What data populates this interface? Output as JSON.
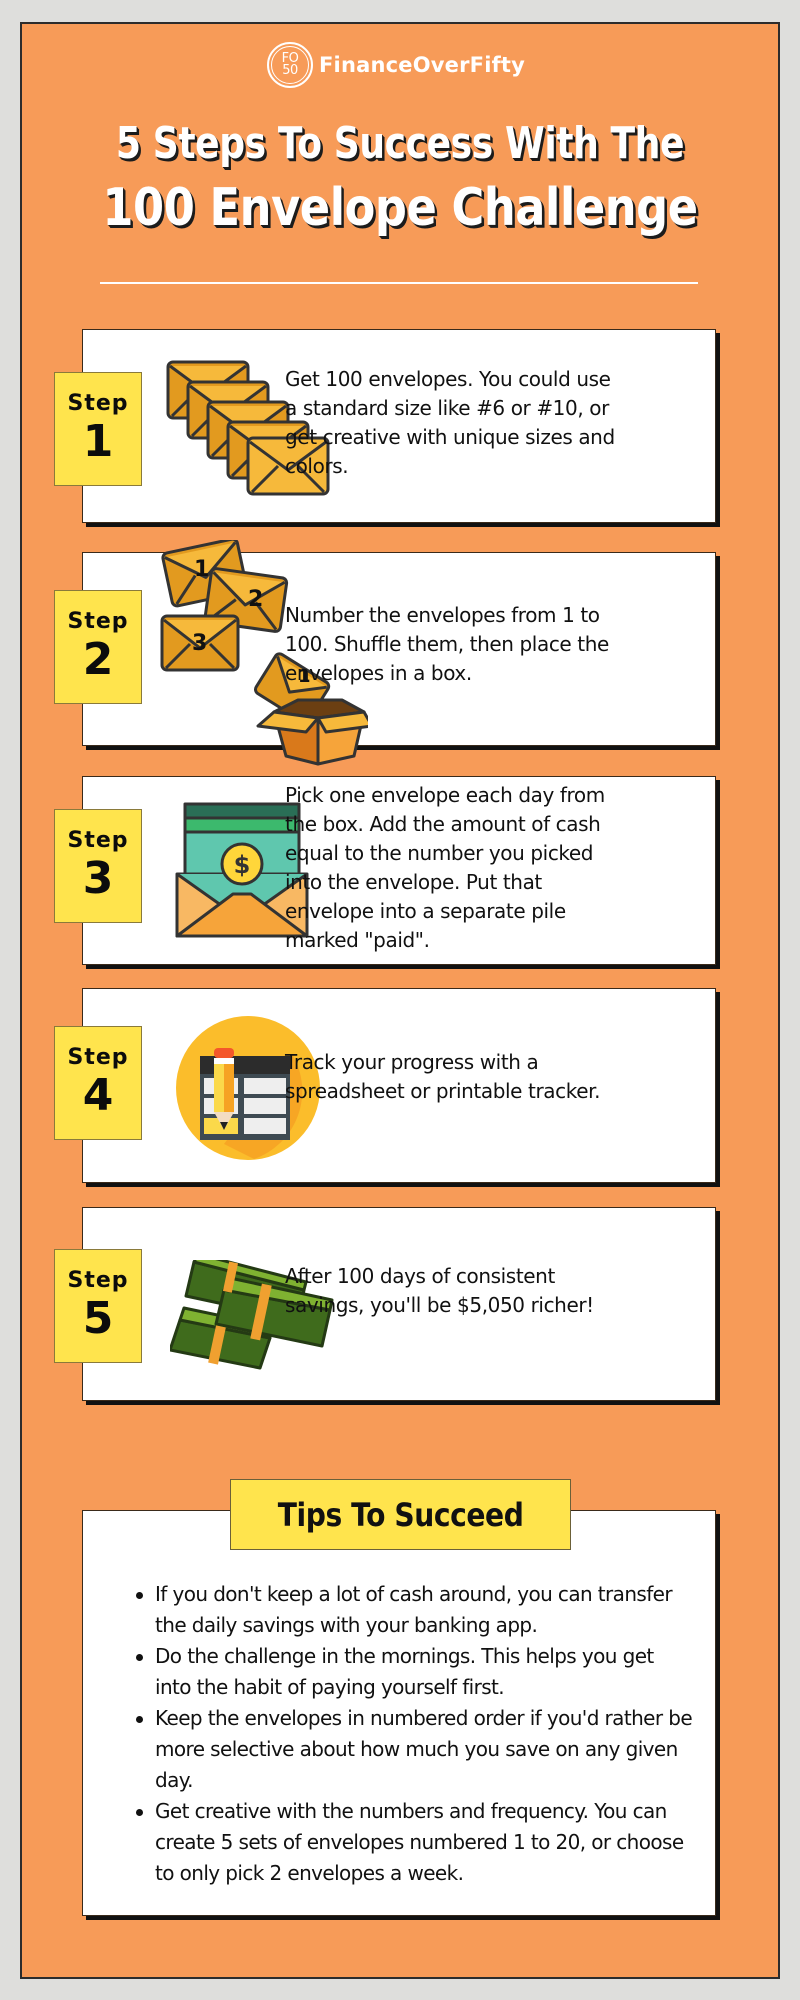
{
  "brand": {
    "logo_monogram_top": "FO",
    "logo_monogram_bottom": "50",
    "name": "FinanceOverFifty"
  },
  "title": {
    "line1": "5 Steps To Success With The",
    "line2": "100 Envelope Challenge"
  },
  "colors": {
    "background": "#f79b58",
    "badge": "#ffe44d",
    "card": "#ffffff",
    "text": "#111111"
  },
  "steps": [
    {
      "label": "Step",
      "number": "1",
      "icon": "envelope-stack-icon",
      "text": "Get 100 envelopes. You could use a standard size like #6 or #10, or get creative with unique sizes and colors."
    },
    {
      "label": "Step",
      "number": "2",
      "icon": "numbered-envelopes-box-icon",
      "icon_numbers": [
        "1",
        "2",
        "3",
        "1"
      ],
      "text": "Number the envelopes from 1 to 100. Shuffle them, then place the envelopes in a box."
    },
    {
      "label": "Step",
      "number": "3",
      "icon": "cash-envelope-icon",
      "icon_symbol": "$",
      "text": "Pick one envelope each day from the box. Add the amount of cash equal to the number you picked into the envelope. Put that envelope into a separate pile marked \"paid\"."
    },
    {
      "label": "Step",
      "number": "4",
      "icon": "spreadsheet-pencil-icon",
      "text": "Track your progress with a spreadsheet or printable tracker."
    },
    {
      "label": "Step",
      "number": "5",
      "icon": "money-stacks-icon",
      "text": "After 100 days of consistent savings, you'll be $5,050 richer!"
    }
  ],
  "tips": {
    "heading": "Tips To Succeed",
    "items": [
      "If you don't keep a lot of cash around, you can transfer the daily savings with your banking app.",
      "Do the challenge in the mornings. This helps you get into the habit of paying yourself first.",
      "Keep the envelopes in numbered order if you'd rather be more selective about how much you save on any given day.",
      "Get creative with the numbers and frequency. You can create 5 sets of envelopes numbered 1 to 20, or choose to only pick 2 envelopes a week."
    ]
  }
}
